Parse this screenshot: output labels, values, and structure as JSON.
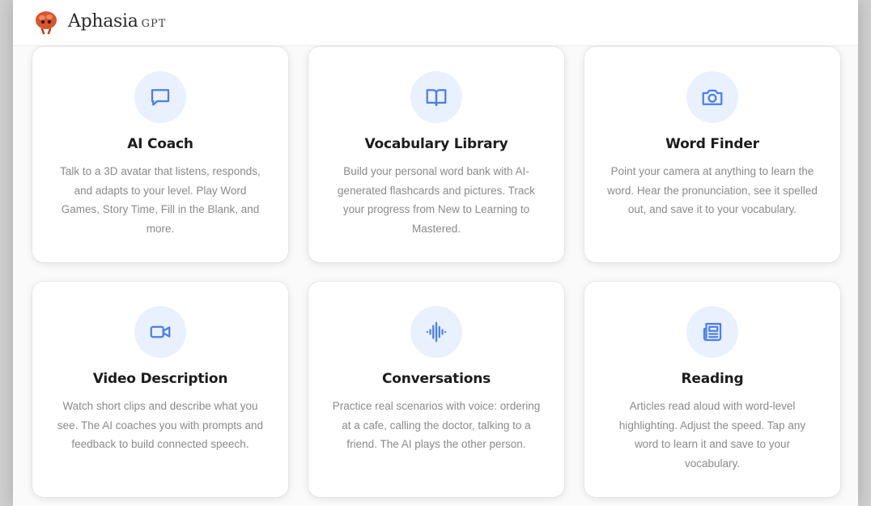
{
  "header": {
    "brand_name": "Aphasia",
    "brand_suffix": "GPT",
    "logo_icon": "brain-mascot-icon"
  },
  "colors": {
    "accent": "#4a7ef0",
    "icon_bg": "#eaf1fe",
    "logo": "#d9542c"
  },
  "cards": [
    {
      "icon": "message-square-icon",
      "title": "AI Coach",
      "description": "Talk to a 3D avatar that listens, responds, and adapts to your level. Play Word Games, Story Time, Fill in the Blank, and more."
    },
    {
      "icon": "book-open-icon",
      "title": "Vocabulary Library",
      "description": "Build your personal word bank with AI-generated flashcards and pictures. Track your progress from New to Learning to Mastered."
    },
    {
      "icon": "camera-icon",
      "title": "Word Finder",
      "description": "Point your camera at anything to learn the word. Hear the pronunciation, see it spelled out, and save it to your vocabulary."
    },
    {
      "icon": "video-camera-icon",
      "title": "Video Description",
      "description": "Watch short clips and describe what you see. The AI coaches you with prompts and feedback to build connected speech."
    },
    {
      "icon": "audio-waveform-icon",
      "title": "Conversations",
      "description": "Practice real scenarios with voice: ordering at a cafe, calling the doctor, talking to a friend. The AI plays the other person."
    },
    {
      "icon": "newspaper-icon",
      "title": "Reading",
      "description": "Articles read aloud with word-level highlighting. Adjust the speed. Tap any word to learn it and save to your vocabulary."
    }
  ]
}
